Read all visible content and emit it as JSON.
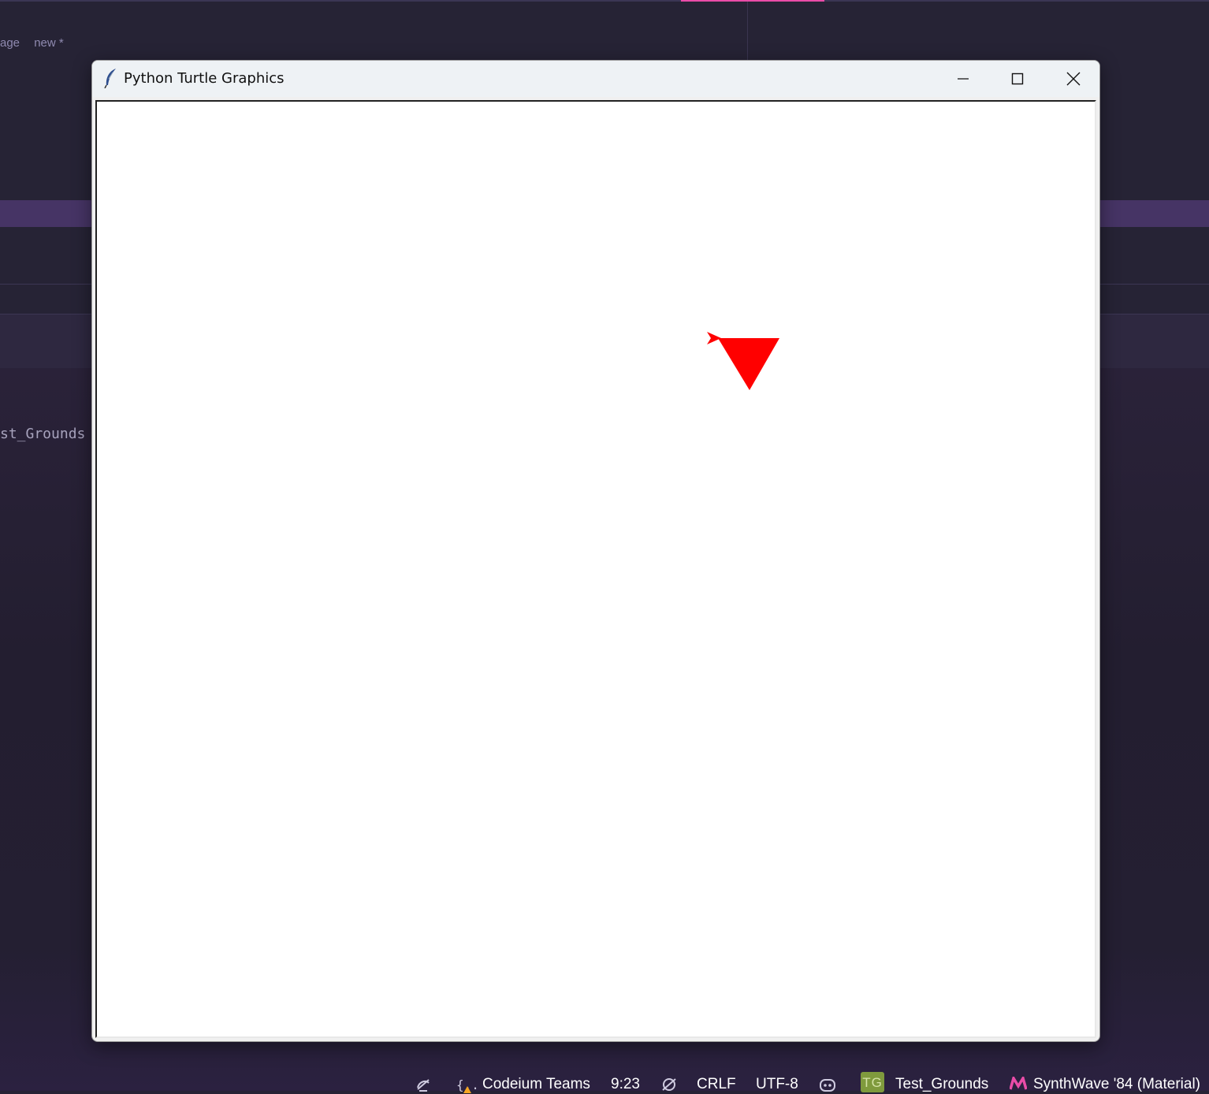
{
  "ide": {
    "tabs": [
      "age",
      "new *"
    ],
    "code_fragment": "st_Grounds"
  },
  "turtle_window": {
    "title": "Python Turtle Graphics",
    "buttons": {
      "minimize": "minimize-icon",
      "maximize": "maximize-icon",
      "close": "close-icon"
    },
    "drawing": {
      "shape_color": "#ff0000",
      "shapes": [
        "filled-triangle",
        "turtle-arrow"
      ]
    }
  },
  "statusbar": {
    "codeium": "Codeium Teams",
    "cursor_position": "9:23",
    "line_ending": "CRLF",
    "encoding": "UTF-8",
    "project_badge": "TG",
    "project_name": "Test_Grounds",
    "theme": "SynthWave '84 (Material)",
    "accent_color": "#e94ca8",
    "badge_color": "#7f9a3d"
  }
}
